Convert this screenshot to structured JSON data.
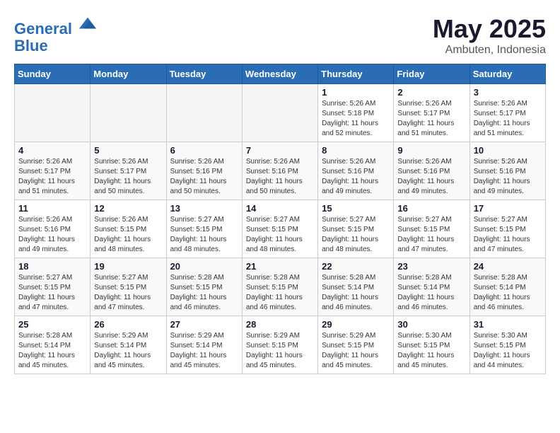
{
  "logo": {
    "line1": "General",
    "line2": "Blue"
  },
  "title": "May 2025",
  "subtitle": "Ambuten, Indonesia",
  "days_of_week": [
    "Sunday",
    "Monday",
    "Tuesday",
    "Wednesday",
    "Thursday",
    "Friday",
    "Saturday"
  ],
  "weeks": [
    [
      {
        "day": "",
        "info": ""
      },
      {
        "day": "",
        "info": ""
      },
      {
        "day": "",
        "info": ""
      },
      {
        "day": "",
        "info": ""
      },
      {
        "day": "1",
        "info": "Sunrise: 5:26 AM\nSunset: 5:18 PM\nDaylight: 11 hours\nand 52 minutes."
      },
      {
        "day": "2",
        "info": "Sunrise: 5:26 AM\nSunset: 5:17 PM\nDaylight: 11 hours\nand 51 minutes."
      },
      {
        "day": "3",
        "info": "Sunrise: 5:26 AM\nSunset: 5:17 PM\nDaylight: 11 hours\nand 51 minutes."
      }
    ],
    [
      {
        "day": "4",
        "info": "Sunrise: 5:26 AM\nSunset: 5:17 PM\nDaylight: 11 hours\nand 51 minutes."
      },
      {
        "day": "5",
        "info": "Sunrise: 5:26 AM\nSunset: 5:17 PM\nDaylight: 11 hours\nand 50 minutes."
      },
      {
        "day": "6",
        "info": "Sunrise: 5:26 AM\nSunset: 5:16 PM\nDaylight: 11 hours\nand 50 minutes."
      },
      {
        "day": "7",
        "info": "Sunrise: 5:26 AM\nSunset: 5:16 PM\nDaylight: 11 hours\nand 50 minutes."
      },
      {
        "day": "8",
        "info": "Sunrise: 5:26 AM\nSunset: 5:16 PM\nDaylight: 11 hours\nand 49 minutes."
      },
      {
        "day": "9",
        "info": "Sunrise: 5:26 AM\nSunset: 5:16 PM\nDaylight: 11 hours\nand 49 minutes."
      },
      {
        "day": "10",
        "info": "Sunrise: 5:26 AM\nSunset: 5:16 PM\nDaylight: 11 hours\nand 49 minutes."
      }
    ],
    [
      {
        "day": "11",
        "info": "Sunrise: 5:26 AM\nSunset: 5:16 PM\nDaylight: 11 hours\nand 49 minutes."
      },
      {
        "day": "12",
        "info": "Sunrise: 5:26 AM\nSunset: 5:15 PM\nDaylight: 11 hours\nand 48 minutes."
      },
      {
        "day": "13",
        "info": "Sunrise: 5:27 AM\nSunset: 5:15 PM\nDaylight: 11 hours\nand 48 minutes."
      },
      {
        "day": "14",
        "info": "Sunrise: 5:27 AM\nSunset: 5:15 PM\nDaylight: 11 hours\nand 48 minutes."
      },
      {
        "day": "15",
        "info": "Sunrise: 5:27 AM\nSunset: 5:15 PM\nDaylight: 11 hours\nand 48 minutes."
      },
      {
        "day": "16",
        "info": "Sunrise: 5:27 AM\nSunset: 5:15 PM\nDaylight: 11 hours\nand 47 minutes."
      },
      {
        "day": "17",
        "info": "Sunrise: 5:27 AM\nSunset: 5:15 PM\nDaylight: 11 hours\nand 47 minutes."
      }
    ],
    [
      {
        "day": "18",
        "info": "Sunrise: 5:27 AM\nSunset: 5:15 PM\nDaylight: 11 hours\nand 47 minutes."
      },
      {
        "day": "19",
        "info": "Sunrise: 5:27 AM\nSunset: 5:15 PM\nDaylight: 11 hours\nand 47 minutes."
      },
      {
        "day": "20",
        "info": "Sunrise: 5:28 AM\nSunset: 5:15 PM\nDaylight: 11 hours\nand 46 minutes."
      },
      {
        "day": "21",
        "info": "Sunrise: 5:28 AM\nSunset: 5:15 PM\nDaylight: 11 hours\nand 46 minutes."
      },
      {
        "day": "22",
        "info": "Sunrise: 5:28 AM\nSunset: 5:14 PM\nDaylight: 11 hours\nand 46 minutes."
      },
      {
        "day": "23",
        "info": "Sunrise: 5:28 AM\nSunset: 5:14 PM\nDaylight: 11 hours\nand 46 minutes."
      },
      {
        "day": "24",
        "info": "Sunrise: 5:28 AM\nSunset: 5:14 PM\nDaylight: 11 hours\nand 46 minutes."
      }
    ],
    [
      {
        "day": "25",
        "info": "Sunrise: 5:28 AM\nSunset: 5:14 PM\nDaylight: 11 hours\nand 45 minutes."
      },
      {
        "day": "26",
        "info": "Sunrise: 5:29 AM\nSunset: 5:14 PM\nDaylight: 11 hours\nand 45 minutes."
      },
      {
        "day": "27",
        "info": "Sunrise: 5:29 AM\nSunset: 5:14 PM\nDaylight: 11 hours\nand 45 minutes."
      },
      {
        "day": "28",
        "info": "Sunrise: 5:29 AM\nSunset: 5:15 PM\nDaylight: 11 hours\nand 45 minutes."
      },
      {
        "day": "29",
        "info": "Sunrise: 5:29 AM\nSunset: 5:15 PM\nDaylight: 11 hours\nand 45 minutes."
      },
      {
        "day": "30",
        "info": "Sunrise: 5:30 AM\nSunset: 5:15 PM\nDaylight: 11 hours\nand 45 minutes."
      },
      {
        "day": "31",
        "info": "Sunrise: 5:30 AM\nSunset: 5:15 PM\nDaylight: 11 hours\nand 44 minutes."
      }
    ]
  ]
}
